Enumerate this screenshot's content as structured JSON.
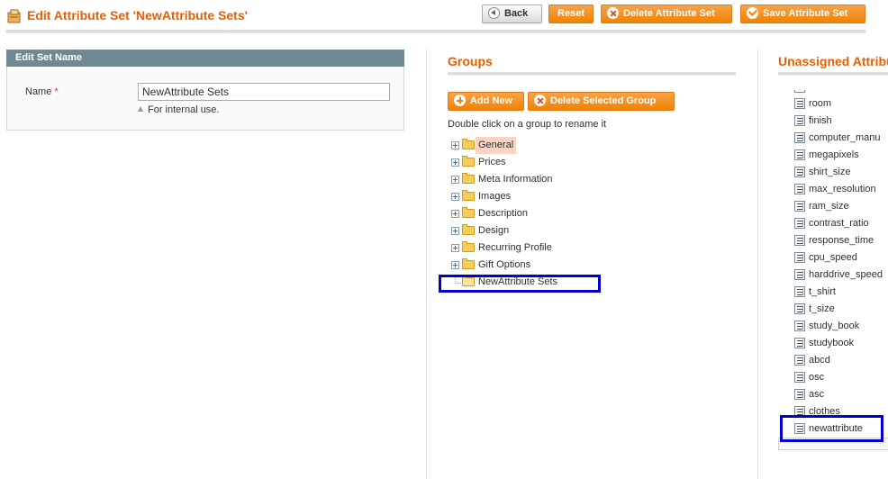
{
  "header": {
    "title": "Edit Attribute Set 'NewAttribute Sets'",
    "buttons": {
      "back": "Back",
      "reset": "Reset",
      "delete": "Delete Attribute Set",
      "save": "Save Attribute Set"
    }
  },
  "edit_set": {
    "heading": "Edit Set Name",
    "name_label": "Name",
    "required_mark": "*",
    "name_value": "NewAttribute Sets",
    "note": "For internal use."
  },
  "groups": {
    "heading": "Groups",
    "add_label": "Add New",
    "delete_label": "Delete Selected Group",
    "hint": "Double click on a group to rename it",
    "items": [
      {
        "label": "General",
        "selected": true
      },
      {
        "label": "Prices"
      },
      {
        "label": "Meta Information"
      },
      {
        "label": "Images"
      },
      {
        "label": "Description"
      },
      {
        "label": "Design"
      },
      {
        "label": "Recurring Profile"
      },
      {
        "label": "Gift Options"
      },
      {
        "label": "NewAttribute Sets",
        "highlighted": true
      }
    ]
  },
  "unassigned": {
    "heading": "Unassigned Attribu",
    "items": [
      "room",
      "finish",
      "computer_manu",
      "megapixels",
      "shirt_size",
      "max_resolution",
      "ram_size",
      "contrast_ratio",
      "response_time",
      "cpu_speed",
      "harddrive_speed",
      "t_shirt",
      "t_size",
      "study_book",
      "studybook",
      "abcd",
      "osc",
      "asc",
      "clothes",
      "newattribute"
    ]
  },
  "colors": {
    "accent": "#eb5e00",
    "button": "#f18200",
    "highlight_box": "#0000cc",
    "selected_bg": "#fbd3c2"
  }
}
